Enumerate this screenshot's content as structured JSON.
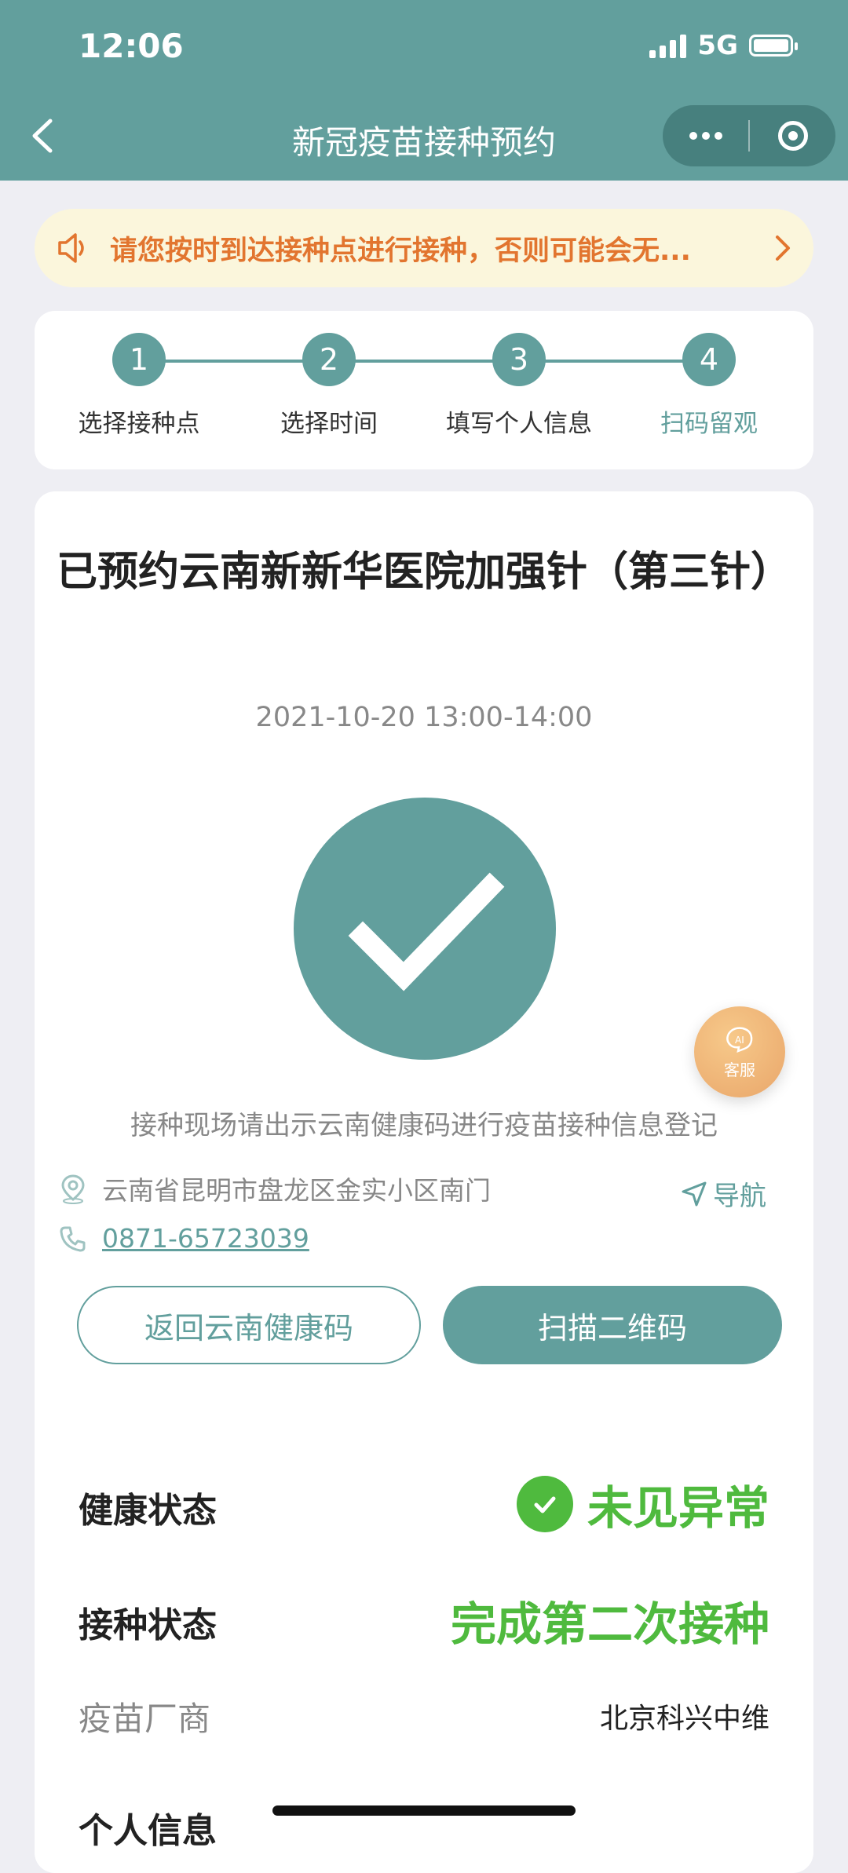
{
  "status_bar": {
    "time": "12:06",
    "network": "5G"
  },
  "nav": {
    "title": "新冠疫苗接种预约"
  },
  "notice": {
    "text": "请您按时到达接种点进行接种，否则可能会无..."
  },
  "steps": [
    {
      "number": "1",
      "label": "选择接种点"
    },
    {
      "number": "2",
      "label": "选择时间"
    },
    {
      "number": "3",
      "label": "填写个人信息"
    },
    {
      "number": "4",
      "label": "扫码留观"
    }
  ],
  "appointment": {
    "title": "已预约云南新新华医院加强针（第三针）",
    "time": "2021-10-20 13:00-14:00",
    "hint": "接种现场请出示云南健康码进行疫苗接种信息登记",
    "address": "云南省昆明市盘龙区金实小区南门",
    "nav_label": "导航",
    "phone": "0871-65723039"
  },
  "buttons": {
    "back_health_code": "返回云南健康码",
    "scan_qr": "扫描二维码"
  },
  "info": {
    "health_label": "健康状态",
    "health_value": "未见异常",
    "vaccination_label": "接种状态",
    "vaccination_value": "完成第二次接种",
    "manufacturer_label": "疫苗厂商",
    "manufacturer_value": "北京科兴中维",
    "personal_info_title": "个人信息"
  },
  "ai_service": {
    "badge": "AI",
    "label": "客服"
  },
  "colors": {
    "primary": "#629f9d",
    "success": "#4fba3e",
    "notice_text": "#e2752f",
    "notice_bg": "#fbf6dc"
  }
}
